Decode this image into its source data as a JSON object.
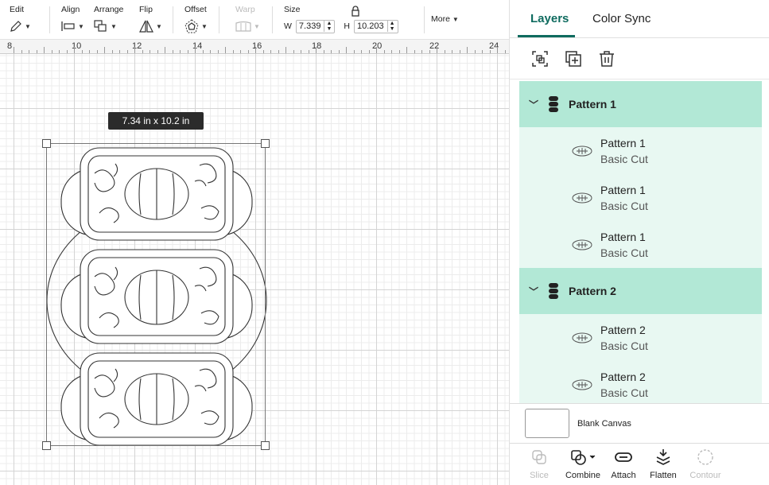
{
  "toolbar": {
    "edit": "Edit",
    "align": "Align",
    "arrange": "Arrange",
    "flip": "Flip",
    "offset": "Offset",
    "warp": "Warp",
    "size": "Size",
    "w_label": "W",
    "w_value": "7.339",
    "h_label": "H",
    "h_value": "10.203",
    "more": "More"
  },
  "ruler": {
    "ticks": [
      "8",
      "10",
      "12",
      "14",
      "16",
      "18",
      "20",
      "22",
      "24"
    ]
  },
  "canvas": {
    "dimension_tooltip": "7.34  in x 10.2  in"
  },
  "panel": {
    "tabs": {
      "layers": "Layers",
      "color_sync": "Color Sync"
    },
    "groups": [
      {
        "name": "Pattern 1",
        "children": [
          {
            "name": "Pattern 1",
            "op": "Basic Cut"
          },
          {
            "name": "Pattern 1",
            "op": "Basic Cut"
          },
          {
            "name": "Pattern 1",
            "op": "Basic Cut"
          }
        ]
      },
      {
        "name": "Pattern 2",
        "children": [
          {
            "name": "Pattern 2",
            "op": "Basic Cut"
          },
          {
            "name": "Pattern 2",
            "op": "Basic Cut"
          }
        ]
      }
    ],
    "blank_canvas": "Blank Canvas",
    "bottom": {
      "slice": "Slice",
      "combine": "Combine",
      "attach": "Attach",
      "flatten": "Flatten",
      "contour": "Contour"
    }
  },
  "colors": {
    "accent": "#0f6b5f",
    "group_bg": "#b2e8d6",
    "child_bg": "#e8f8f2"
  }
}
